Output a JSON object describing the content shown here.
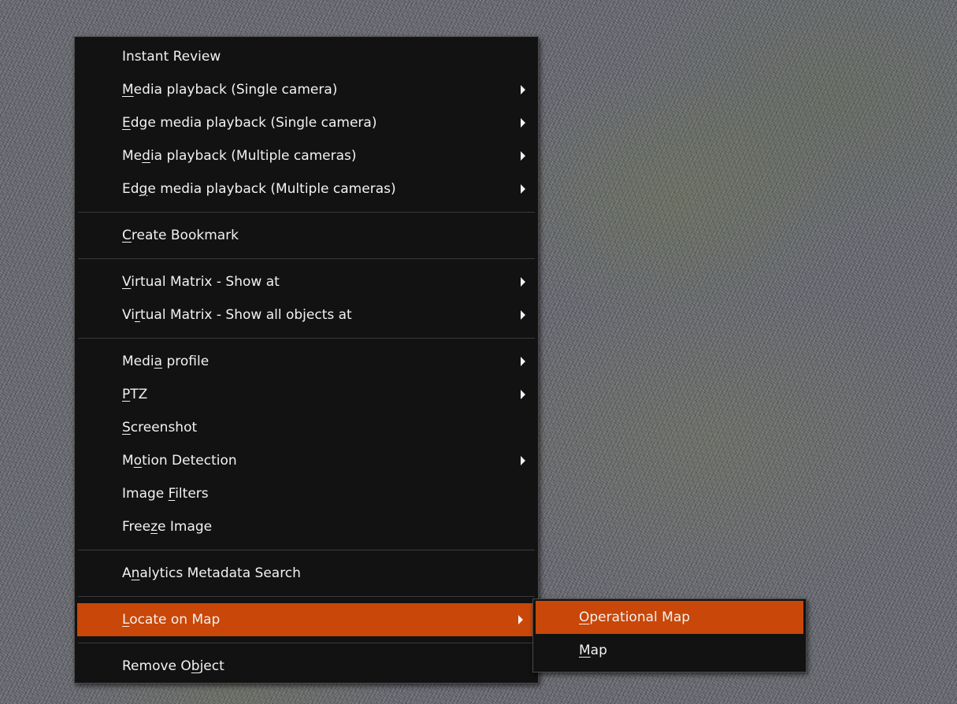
{
  "context_menu": {
    "groups": [
      [
        {
          "id": "instant-review",
          "parts": [
            "",
            "",
            "Instant Review"
          ],
          "submenu": false
        },
        {
          "id": "media-playback-single",
          "parts": [
            "",
            "M",
            "edia playback (Single camera)"
          ],
          "submenu": true
        },
        {
          "id": "edge-media-playback-single",
          "parts": [
            "",
            "E",
            "dge media playback (Single camera)"
          ],
          "submenu": true
        },
        {
          "id": "media-playback-multiple",
          "parts": [
            "Me",
            "d",
            "ia playback (Multiple cameras)"
          ],
          "submenu": true
        },
        {
          "id": "edge-media-playback-multiple",
          "parts": [
            "Ed",
            "g",
            "e media playback (Multiple cameras)"
          ],
          "submenu": true
        }
      ],
      [
        {
          "id": "create-bookmark",
          "parts": [
            "",
            "C",
            "reate Bookmark"
          ],
          "submenu": false
        }
      ],
      [
        {
          "id": "virtual-matrix-show-at",
          "parts": [
            "",
            "V",
            "irtual Matrix - Show at"
          ],
          "submenu": true
        },
        {
          "id": "virtual-matrix-show-all",
          "parts": [
            "Vi",
            "r",
            "tual Matrix - Show all objects at"
          ],
          "submenu": true
        }
      ],
      [
        {
          "id": "media-profile",
          "parts": [
            "Medi",
            "a",
            " profile"
          ],
          "submenu": true
        },
        {
          "id": "ptz",
          "parts": [
            "",
            "P",
            "TZ"
          ],
          "submenu": true
        },
        {
          "id": "screenshot",
          "parts": [
            "",
            "S",
            "creenshot"
          ],
          "submenu": false
        },
        {
          "id": "motion-detection",
          "parts": [
            "M",
            "o",
            "tion Detection"
          ],
          "submenu": true
        },
        {
          "id": "image-filters",
          "parts": [
            "Image ",
            "F",
            "ilters"
          ],
          "submenu": false
        },
        {
          "id": "freeze-image",
          "parts": [
            "Free",
            "z",
            "e Image"
          ],
          "submenu": false
        }
      ],
      [
        {
          "id": "analytics-metadata-search",
          "parts": [
            "A",
            "n",
            "alytics Metadata Search"
          ],
          "submenu": false
        }
      ],
      [
        {
          "id": "locate-on-map",
          "parts": [
            "",
            "L",
            "ocate on Map"
          ],
          "submenu": true,
          "active": true
        }
      ],
      [
        {
          "id": "remove-object",
          "parts": [
            "Remove O",
            "b",
            "ject"
          ],
          "submenu": false
        }
      ]
    ]
  },
  "submenu_locate_on_map": {
    "items": [
      {
        "id": "operational-map",
        "parts": [
          "",
          "O",
          "perational Map"
        ],
        "active": true
      },
      {
        "id": "map",
        "parts": [
          "",
          "M",
          "ap"
        ],
        "active": false
      }
    ]
  },
  "colors": {
    "highlight": "#c94708",
    "menu_background": "#121212",
    "menu_text": "#f2f2f2",
    "separator": "#3a3a3a"
  },
  "icons": {
    "submenu_indicator": "chevron-right-icon"
  }
}
